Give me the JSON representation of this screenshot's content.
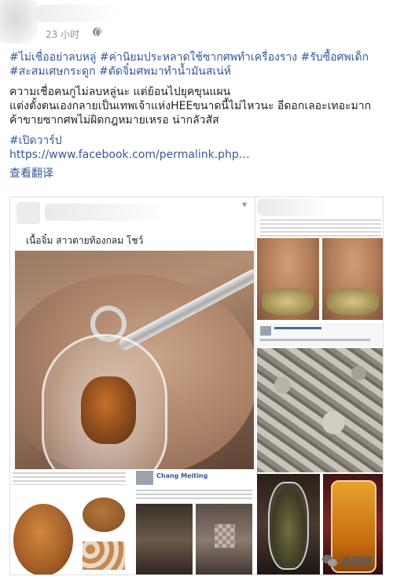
{
  "post": {
    "timestamp": "23 小时",
    "privacy_icon": "globe-icon",
    "hashtags_line1": "#ไม่เชื่ออย่าลบหลู่ #ค่านิยมประหลาดใช้ซากศพทำเครื่องราง #รับซื้อศพเด็ก",
    "hashtags_line2": "#สะสมเศษกระดูก #ตัดจิ๋มศพมาทำน้ำมันสเน่ห์",
    "caption_line1": "ความเชื่อคนกูไม่ลบหลู่นะ แต่ย้อนไปยุคขุนแผน",
    "caption_line2": "แต่งตั้งตนเองกลายเป็นเทพเจ้าแห่งHEEขนาดนี้ไม่ไหวนะ อีดอกเลอะเทอะมาก",
    "caption_line3": "ค้าขายซากศพไม่ผิดกฎหมายเหรอ น่ากลัวสัส",
    "open_hashtag": "#เปิดวาร์ป",
    "link": "https://www.facebook.com/permalink.php…",
    "translate": "查看翻译"
  },
  "shared": {
    "more_icon": "chevron-down-icon",
    "left_caption": "เนื้อจิ๋ม สาวตายท้องกลม โชว์",
    "thumb_profile_name": "Chang Meiting"
  },
  "watermark": {
    "text": "泰国网",
    "icon": "wechat-icon"
  }
}
